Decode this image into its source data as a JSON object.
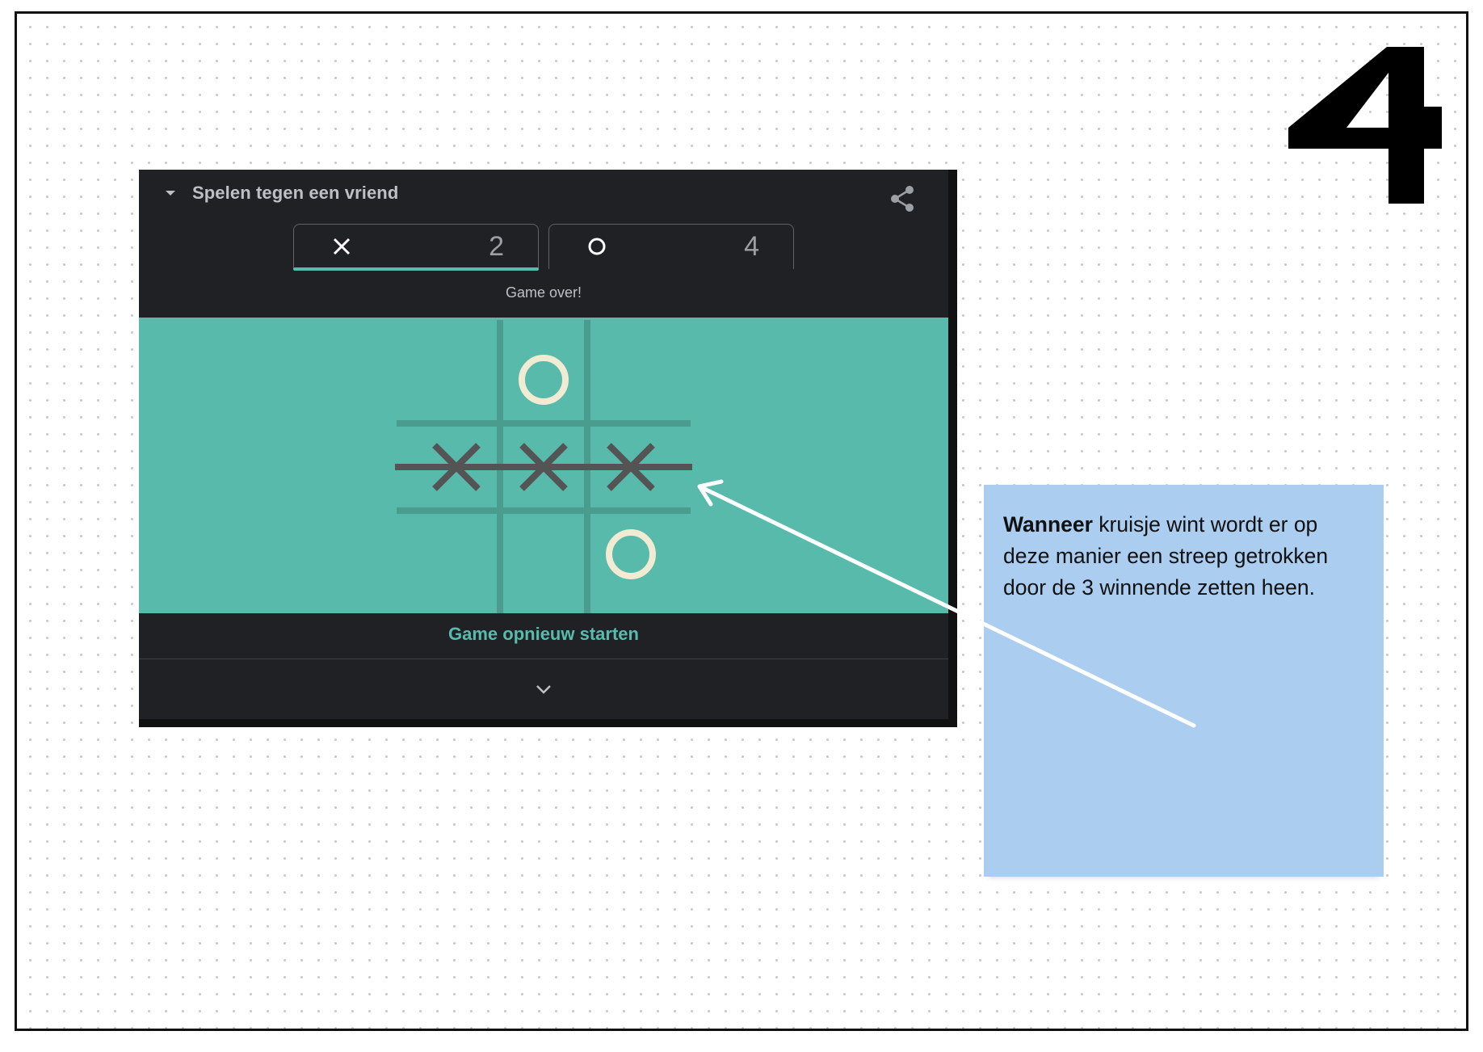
{
  "step_number": "4",
  "game": {
    "mode_title": "Spelen tegen een vriend",
    "players": [
      {
        "mark": "x-mark-icon",
        "score": "2",
        "active": true
      },
      {
        "mark": "o-mark-icon",
        "score": "4",
        "active": false
      }
    ],
    "status": "Game over!",
    "board": [
      [
        "",
        "O",
        ""
      ],
      [
        "X",
        "X",
        "X"
      ],
      [
        "",
        "",
        "O"
      ]
    ],
    "winning_line": "row-2",
    "restart_label": "Game opnieuw starten",
    "icons": {
      "menu": "caret-down-icon",
      "share": "share-icon",
      "expand": "chevron-down-icon"
    }
  },
  "annotation": {
    "bold_lead": "Wanneer",
    "text": " kruisje wint wordt er op deze manier een streep getrokken door de 3 winnende zetten heen."
  },
  "colors": {
    "panel_bg": "#202124",
    "board_bg": "#57baab",
    "grid_line": "#4a9c8e",
    "x_mark": "#545454",
    "o_mark": "#f2ebd3",
    "accent": "#57bbad",
    "note_bg": "#abcdf0",
    "arrow": "#ffffff"
  }
}
